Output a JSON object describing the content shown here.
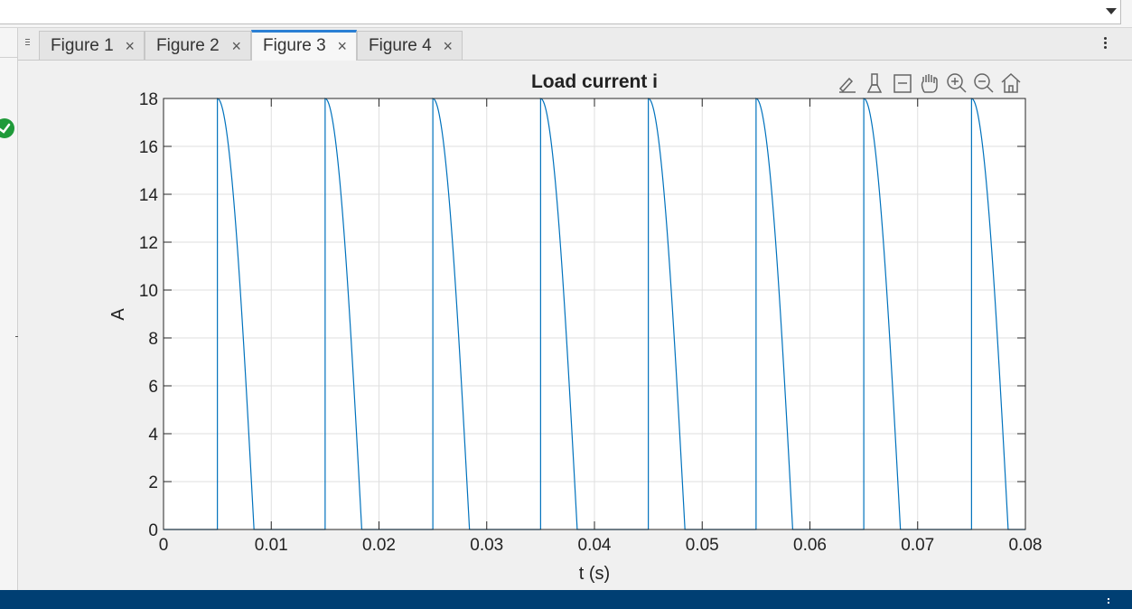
{
  "tabs": [
    {
      "label": "Figure 1",
      "close": "×",
      "active": false
    },
    {
      "label": "Figure 2",
      "close": "×",
      "active": false
    },
    {
      "label": "Figure 3",
      "close": "×",
      "active": true
    },
    {
      "label": "Figure 4",
      "close": "×",
      "active": false
    }
  ],
  "axes_toolbar": [
    "brush-edit-icon",
    "data-cursor-icon",
    "restore-view-icon",
    "pan-icon",
    "zoom-in-icon",
    "zoom-out-icon",
    "home-icon"
  ],
  "colors": {
    "accent": "#2a7fd4",
    "line": "#0072bd",
    "statusbar": "#003f73",
    "ok": "#1f9a3a"
  },
  "chart_data": {
    "type": "line",
    "title": "Load current i",
    "xlabel": "t (s)",
    "ylabel": "A",
    "xlim": [
      0,
      0.08
    ],
    "ylim": [
      0,
      18
    ],
    "xticks": [
      "0",
      "0.01",
      "0.02",
      "0.03",
      "0.04",
      "0.05",
      "0.06",
      "0.07",
      "0.08"
    ],
    "yticks": [
      "0",
      "2",
      "4",
      "6",
      "8",
      "10",
      "12",
      "14",
      "16",
      "18"
    ],
    "grid": true,
    "series": [
      {
        "description_points": [
          {
            "x": 0.0,
            "y": 0
          },
          {
            "x": 0.005,
            "y": 0
          },
          {
            "x": 0.005,
            "y": 18
          },
          {
            "x": 0.0084,
            "y": 0
          },
          {
            "x": 0.015,
            "y": 0
          },
          {
            "x": 0.015,
            "y": 18
          },
          {
            "x": 0.0184,
            "y": 0
          },
          {
            "x": 0.025,
            "y": 0
          },
          {
            "x": 0.025,
            "y": 18
          },
          {
            "x": 0.0284,
            "y": 0
          },
          {
            "x": 0.035,
            "y": 0
          },
          {
            "x": 0.035,
            "y": 18
          },
          {
            "x": 0.0384,
            "y": 0
          },
          {
            "x": 0.045,
            "y": 0
          },
          {
            "x": 0.045,
            "y": 18
          },
          {
            "x": 0.0484,
            "y": 0
          },
          {
            "x": 0.055,
            "y": 0
          },
          {
            "x": 0.055,
            "y": 18
          },
          {
            "x": 0.0584,
            "y": 0
          },
          {
            "x": 0.065,
            "y": 0
          },
          {
            "x": 0.065,
            "y": 18
          },
          {
            "x": 0.0684,
            "y": 0
          },
          {
            "x": 0.075,
            "y": 0
          },
          {
            "x": 0.075,
            "y": 18
          },
          {
            "x": 0.0784,
            "y": 0
          },
          {
            "x": 0.08,
            "y": 0
          }
        ],
        "pulse_starts": [
          0.005,
          0.015,
          0.025,
          0.035,
          0.045,
          0.055,
          0.065,
          0.075
        ],
        "pulse_peak": 18,
        "pulse_width": 0.0034
      }
    ]
  }
}
